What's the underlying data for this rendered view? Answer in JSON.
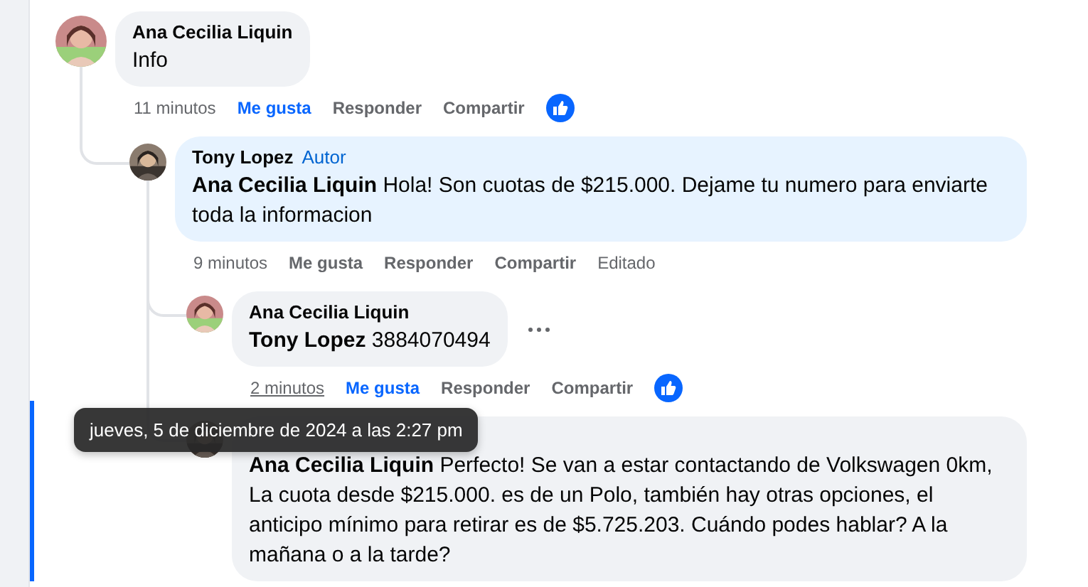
{
  "comments": [
    {
      "author": "Ana Cecilia Liquin",
      "text": "Info",
      "color": "#f0f2f5",
      "focused": false,
      "time": "11 minutos",
      "time_hovered": false,
      "like_label": "Me gusta",
      "liked": true,
      "reply_label": "Responder",
      "share_label": "Compartir",
      "children": [
        {
          "author": "Tony Lopez",
          "badge": "Autor",
          "text": "**Ana Cecilia Liquin** Hola! Son cuotas de $215.000. Dejame tu numero para enviarte toda la informacion",
          "color": "#e7f3ff",
          "focused": false,
          "time": "9 minutos",
          "time_hovered": false,
          "like_label": "Me gusta",
          "liked": false,
          "reply_label": "Responder",
          "share_label": "Compartir",
          "edited_label": "Editado",
          "children": [
            {
              "author": "Ana Cecilia Liquin",
              "text": "**Tony Lopez** 3884070494",
              "color": "#f0f2f5",
              "focused": false,
              "show_more_menu": true,
              "time": "2 minutos",
              "time_hovered": true,
              "like_label": "Me gusta",
              "liked": true,
              "reply_label": "Responder",
              "share_label": "Compartir"
            },
            {
              "text": "**Ana Cecilia Liquin** Perfecto! Se van a estar contactando de Volkswagen 0km, La cuota desde $215.000. es de un Polo, también hay otras opciones, el anticipo mínimo para retirar es de $5.725.203. Cuándo podes hablar? A la mañana o a la tarde?",
              "color": "#f0f2f5",
              "focused": true
            }
          ]
        }
      ]
    }
  ],
  "tooltip": {
    "text": "jueves, 5 de diciembre de 2024 a las 2:27 pm"
  }
}
